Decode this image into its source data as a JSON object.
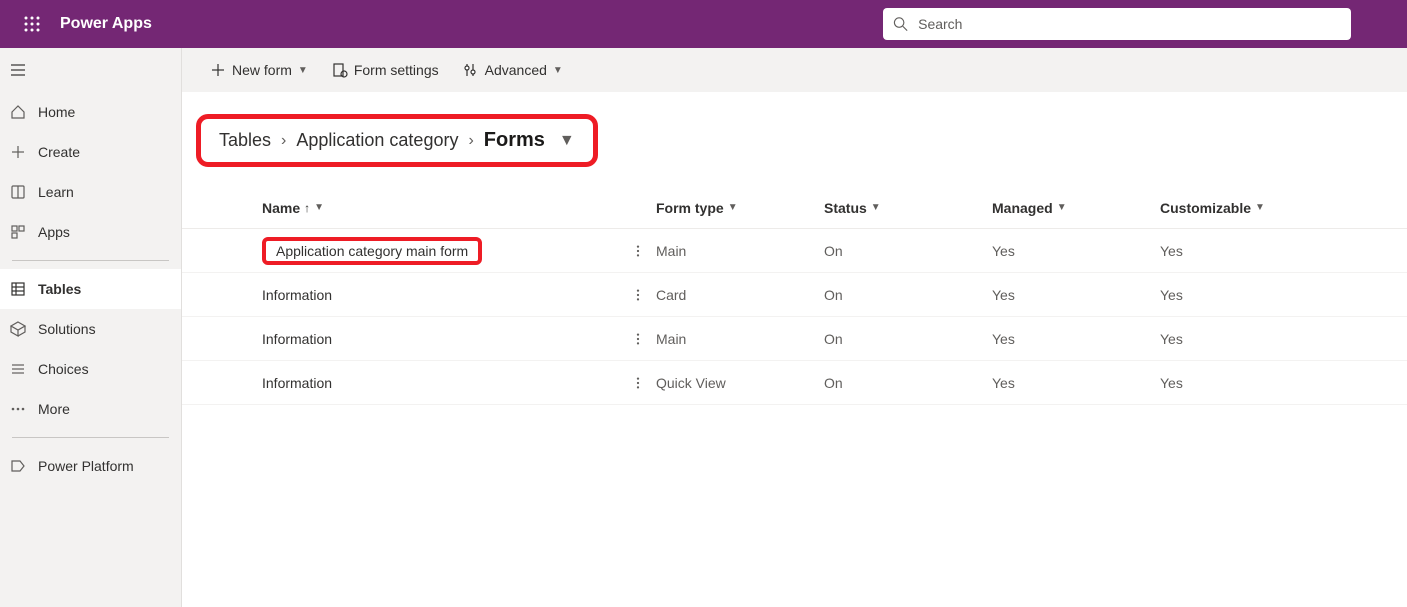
{
  "header": {
    "app_title": "Power Apps",
    "search_placeholder": "Search"
  },
  "sidebar": {
    "items": [
      {
        "id": "home",
        "label": "Home",
        "icon": "home"
      },
      {
        "id": "create",
        "label": "Create",
        "icon": "plus"
      },
      {
        "id": "learn",
        "label": "Learn",
        "icon": "book"
      },
      {
        "id": "apps",
        "label": "Apps",
        "icon": "apps"
      },
      {
        "id": "tables",
        "label": "Tables",
        "icon": "grid",
        "active": true
      },
      {
        "id": "solutions",
        "label": "Solutions",
        "icon": "cube"
      },
      {
        "id": "choices",
        "label": "Choices",
        "icon": "list"
      },
      {
        "id": "more",
        "label": "More",
        "icon": "dots"
      },
      {
        "id": "powerplatform",
        "label": "Power Platform",
        "icon": "platform"
      }
    ]
  },
  "commands": {
    "new_form": "New form",
    "form_settings": "Form settings",
    "advanced": "Advanced"
  },
  "breadcrumb": {
    "parts": [
      "Tables",
      "Application category"
    ],
    "current": "Forms"
  },
  "table": {
    "columns": {
      "name": "Name",
      "form_type": "Form type",
      "status": "Status",
      "managed": "Managed",
      "customizable": "Customizable"
    },
    "rows": [
      {
        "name": "Application category main form",
        "form_type": "Main",
        "status": "On",
        "managed": "Yes",
        "customizable": "Yes",
        "highlight": true
      },
      {
        "name": "Information",
        "form_type": "Card",
        "status": "On",
        "managed": "Yes",
        "customizable": "Yes"
      },
      {
        "name": "Information",
        "form_type": "Main",
        "status": "On",
        "managed": "Yes",
        "customizable": "Yes"
      },
      {
        "name": "Information",
        "form_type": "Quick View",
        "status": "On",
        "managed": "Yes",
        "customizable": "Yes"
      }
    ]
  }
}
